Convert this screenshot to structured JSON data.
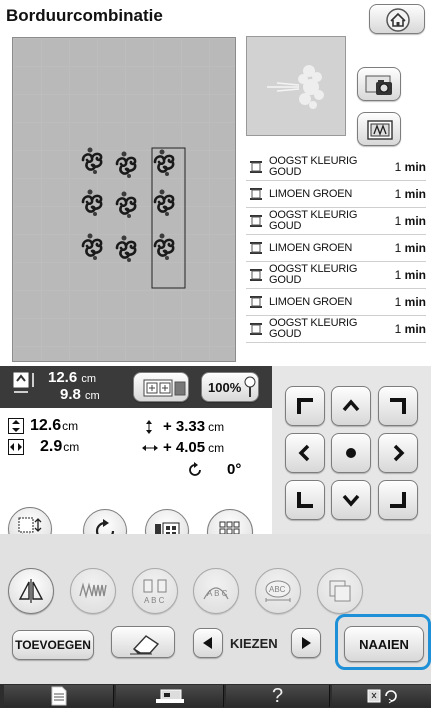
{
  "screen": {
    "title": "Borduurcombinatie"
  },
  "thread_list": [
    {
      "color": "OOGST KLEURIG GOUD",
      "line1": "OOGST KLEURIG",
      "line2": "GOUD",
      "time_value": "1",
      "time_unit": "min"
    },
    {
      "color": "LIMOEN GROEN",
      "line1": "LIMOEN GROEN",
      "line2": "",
      "time_value": "1",
      "time_unit": "min"
    },
    {
      "color": "OOGST KLEURIG GOUD",
      "line1": "OOGST KLEURIG",
      "line2": "GOUD",
      "time_value": "1",
      "time_unit": "min"
    },
    {
      "color": "LIMOEN GROEN",
      "line1": "LIMOEN GROEN",
      "line2": "",
      "time_value": "1",
      "time_unit": "min"
    },
    {
      "color": "OOGST KLEURIG GOUD",
      "line1": "OOGST KLEURIG",
      "line2": "GOUD",
      "time_value": "1",
      "time_unit": "min"
    },
    {
      "color": "LIMOEN GROEN",
      "line1": "LIMOEN GROEN",
      "line2": "",
      "time_value": "1",
      "time_unit": "min"
    },
    {
      "color": "OOGST KLEURIG GOUD",
      "line1": "OOGST KLEURIG",
      "line2": "GOUD",
      "time_value": "1",
      "time_unit": "min"
    }
  ],
  "size_display": {
    "height_value": "12.6",
    "height_unit": "cm",
    "width_value": "9.8",
    "width_unit": "cm",
    "zoom": "100%"
  },
  "pattern_info": {
    "height_value": "12.6",
    "height_unit": "cm",
    "width_value": "2.9",
    "width_unit": "cm",
    "offset_v": "+ 3.33",
    "offset_v_unit": "cm",
    "offset_h": "+ 4.05",
    "offset_h_unit": "cm",
    "rotation": "0°"
  },
  "buttons": {
    "add": "TOEVOEGEN",
    "select": "KIEZEN",
    "sew": "NAAIEN",
    "help": "?"
  },
  "icons": {
    "home": "home-icon",
    "camera": "camera-icon",
    "background_image": "background-image-icon",
    "document": "document-icon",
    "sewing_machine": "machine-icon",
    "settings": "settings-icon"
  },
  "colors": {
    "accent_highlight": "#1e90d8",
    "dark_bar": "#3a3a3a",
    "canvas": "#b9b9b9"
  }
}
